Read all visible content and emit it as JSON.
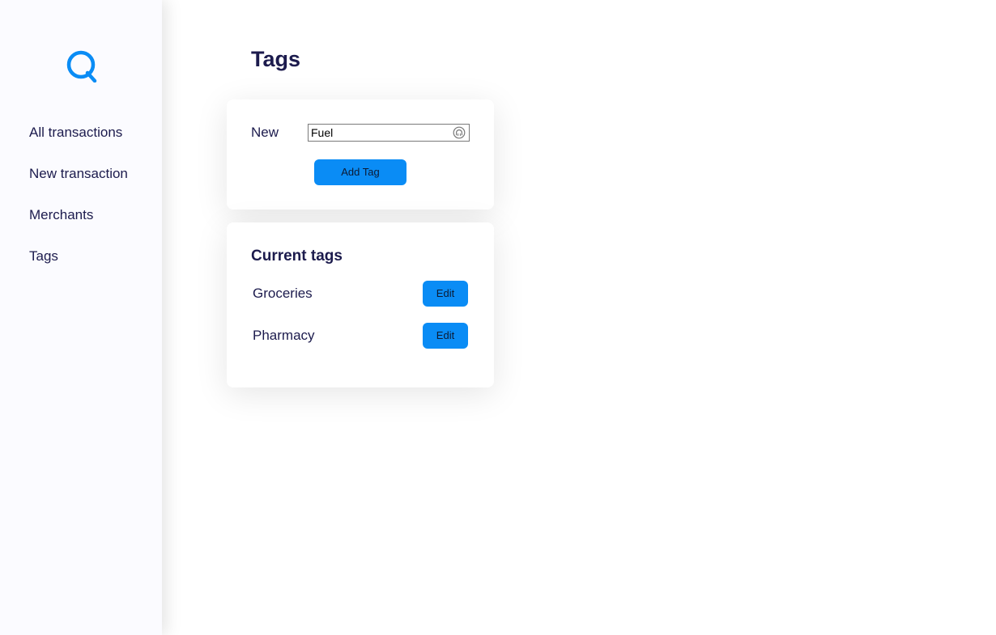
{
  "sidebar": {
    "logo_letter": "Q",
    "items": [
      {
        "label": "All transactions"
      },
      {
        "label": "New transaction"
      },
      {
        "label": "Merchants"
      },
      {
        "label": "Tags"
      }
    ]
  },
  "page": {
    "title": "Tags"
  },
  "new_tag": {
    "label": "New",
    "input_value": "Fuel",
    "input_icon": "password-manager-icon",
    "add_button_label": "Add Tag"
  },
  "current_tags": {
    "title": "Current tags",
    "items": [
      {
        "name": "Groceries",
        "edit_label": "Edit"
      },
      {
        "name": "Pharmacy",
        "edit_label": "Edit"
      }
    ]
  },
  "colors": {
    "accent": "#0a8cf5",
    "text": "#1c1b4d",
    "sidebar_bg": "#fbfbff"
  }
}
